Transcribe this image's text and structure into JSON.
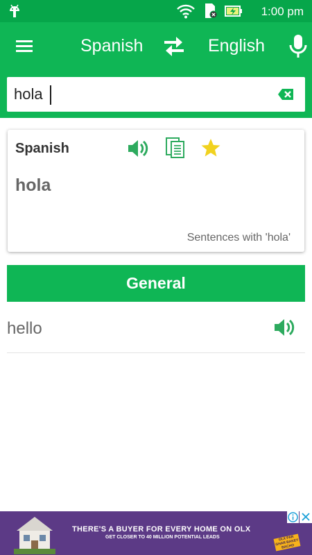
{
  "status_bar": {
    "time": "1:00 pm",
    "icons": [
      "android-icon",
      "wifi-icon",
      "sd-card-icon",
      "battery-charging-icon"
    ]
  },
  "toolbar": {
    "source_language": "Spanish",
    "target_language": "English",
    "icons": [
      "menu-icon",
      "swap-icon",
      "microphone-icon"
    ]
  },
  "search": {
    "value": "hola"
  },
  "result_card": {
    "language": "Spanish",
    "word": "hola",
    "sentences_link": "Sentences with 'hola'"
  },
  "section": {
    "title": "General"
  },
  "results": [
    {
      "word": "hello"
    }
  ],
  "ad": {
    "headline": "THERE'S A BUYER FOR EVERY HOME ON OLX",
    "subline": "GET CLOSER TO 40 MILLION POTENTIAL LEADS",
    "badge": "OLX PAR GHAR BAKEY BACHO"
  },
  "colors": {
    "primary": "#0fb655",
    "status_bar": "#06a64a",
    "icon_green": "#2daa5e",
    "star": "#f1d21f",
    "ad_background": "#5c3a86"
  }
}
